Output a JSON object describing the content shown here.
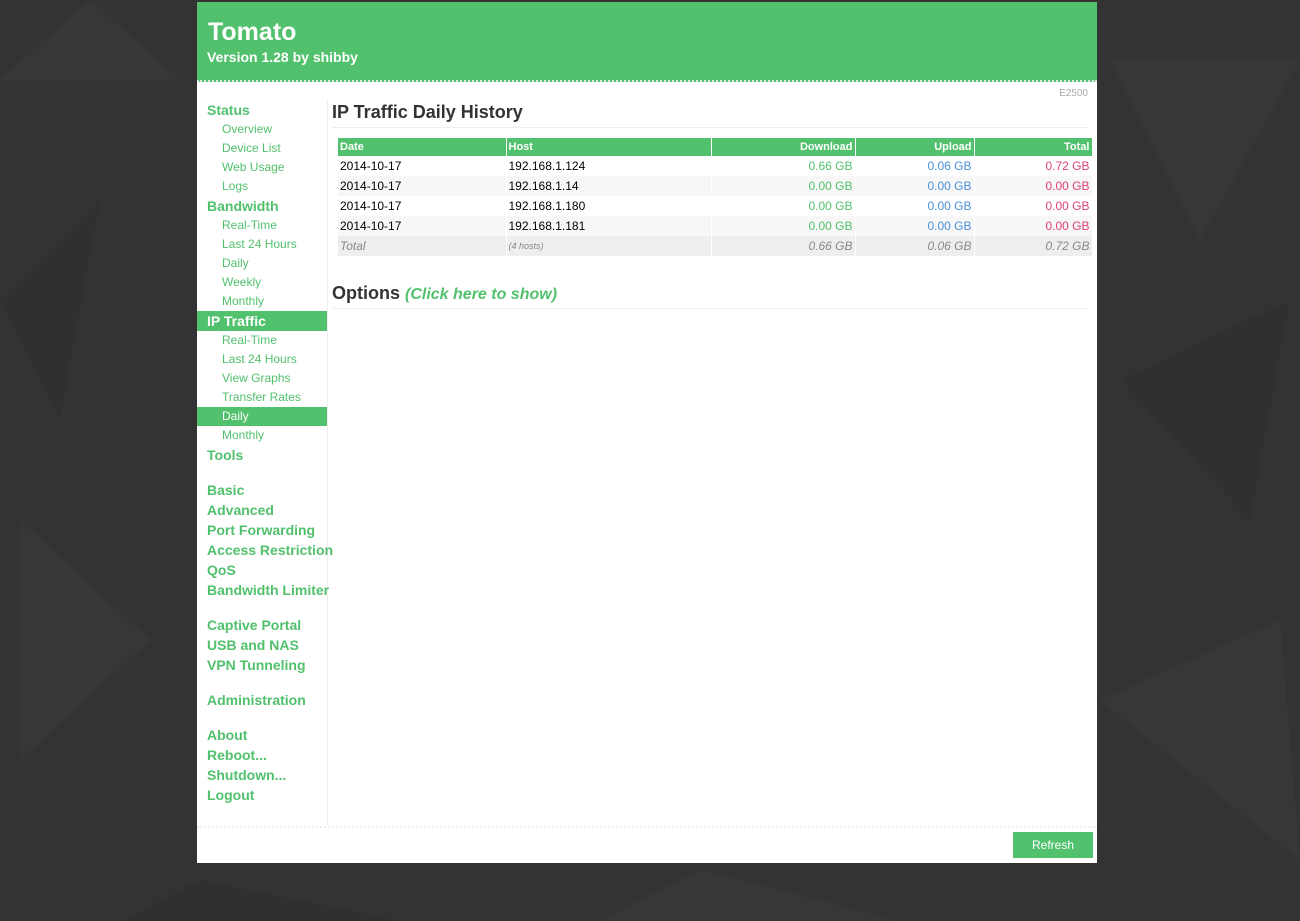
{
  "header": {
    "title": "Tomato",
    "version": "Version 1.28 by shibby"
  },
  "model": "E2500",
  "sidebar": {
    "status": {
      "label": "Status",
      "items": [
        "Overview",
        "Device List",
        "Web Usage",
        "Logs"
      ]
    },
    "bandwidth": {
      "label": "Bandwidth",
      "items": [
        "Real-Time",
        "Last 24 Hours",
        "Daily",
        "Weekly",
        "Monthly"
      ]
    },
    "ip_traffic": {
      "label": "IP Traffic",
      "items": [
        "Real-Time",
        "Last 24 Hours",
        "View Graphs",
        "Transfer Rates",
        "Daily",
        "Monthly"
      ]
    },
    "tools": "Tools",
    "group2": [
      "Basic",
      "Advanced",
      "Port Forwarding",
      "Access Restriction",
      "QoS",
      "Bandwidth Limiter"
    ],
    "group3": [
      "Captive Portal",
      "USB and NAS",
      "VPN Tunneling"
    ],
    "group4": [
      "Administration"
    ],
    "group5": [
      "About",
      "Reboot...",
      "Shutdown...",
      "Logout"
    ]
  },
  "page_title": "IP Traffic Daily History",
  "table": {
    "headers": {
      "date": "Date",
      "host": "Host",
      "download": "Download",
      "upload": "Upload",
      "total": "Total"
    },
    "rows": [
      {
        "date": "2014-10-17",
        "host": "192.168.1.124",
        "download": "0.66 GB",
        "upload": "0.06 GB",
        "total": "0.72 GB"
      },
      {
        "date": "2014-10-17",
        "host": "192.168.1.14",
        "download": "0.00 GB",
        "upload": "0.00 GB",
        "total": "0.00 GB"
      },
      {
        "date": "2014-10-17",
        "host": "192.168.1.180",
        "download": "0.00 GB",
        "upload": "0.00 GB",
        "total": "0.00 GB"
      },
      {
        "date": "2014-10-17",
        "host": "192.168.1.181",
        "download": "0.00 GB",
        "upload": "0.00 GB",
        "total": "0.00 GB"
      }
    ],
    "total": {
      "label": "Total",
      "hosts": "(4 hosts)",
      "download": "0.66 GB",
      "upload": "0.06 GB",
      "total": "0.72 GB"
    }
  },
  "options": {
    "label": "Options",
    "link": "(Click here to show)"
  },
  "refresh_label": "Refresh",
  "colors": {
    "accent": "#52c16d",
    "upload": "#4a90d9",
    "total": "#e0407b",
    "background": "#333333"
  }
}
